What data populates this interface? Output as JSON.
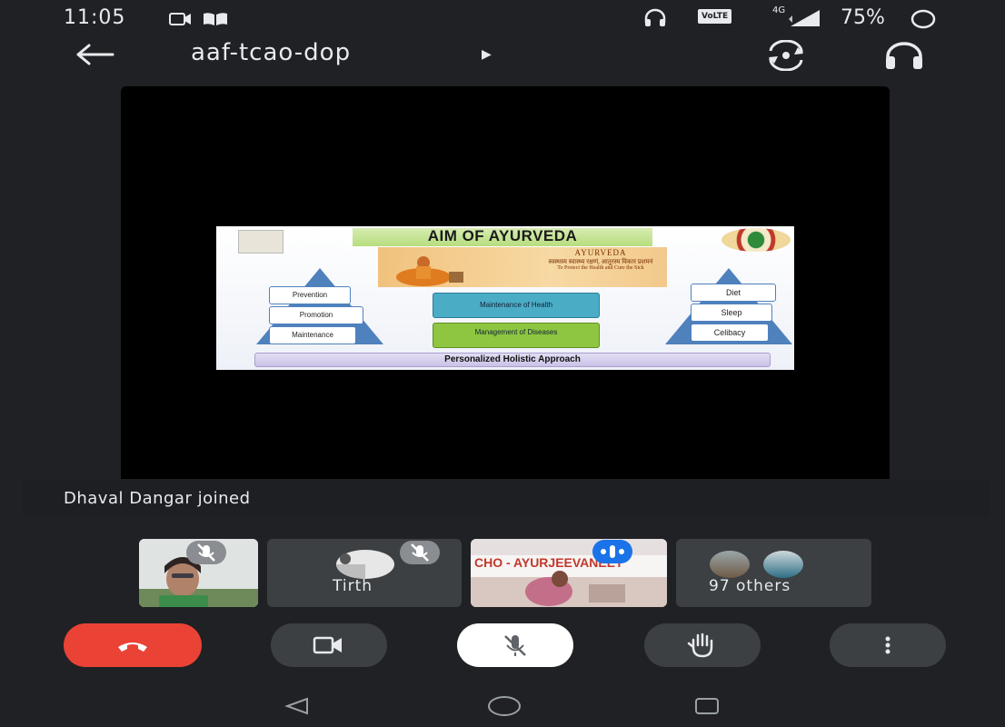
{
  "status_bar": {
    "time": "11:05",
    "network_label": "VoLTE",
    "signal_label": "4G",
    "battery": "75%"
  },
  "top_bar": {
    "meeting_code": "aaf-tcao-dop"
  },
  "slide": {
    "title": "AIM OF AYURVEDA",
    "banner_heading": "AYURVEDA",
    "banner_sanskrit": "स्वस्थस्य स्वास्थ्य रक्षणं, आतुरस्य विकार प्रशमनं",
    "banner_english": "To Protect the Health and Cure the Sick",
    "left_pyramid": [
      "Prevention",
      "Promotion",
      "Maintenance"
    ],
    "center_boxes": [
      "Maintenance of Health",
      "Management of Diseases"
    ],
    "right_pyramid": [
      "Diet",
      "Sleep",
      "Celibacy"
    ],
    "footer": "Personalized Holistic Approach"
  },
  "toast": {
    "message": "Dhaval Dangar joined"
  },
  "participants": {
    "tile2_name": "Tirth",
    "tile3_banner": "CHO - AYURJEEVANEET",
    "others_label": "97 others"
  },
  "colors": {
    "end_call": "#ea4335",
    "speaking": "#1a73e8",
    "background": "#202124"
  }
}
